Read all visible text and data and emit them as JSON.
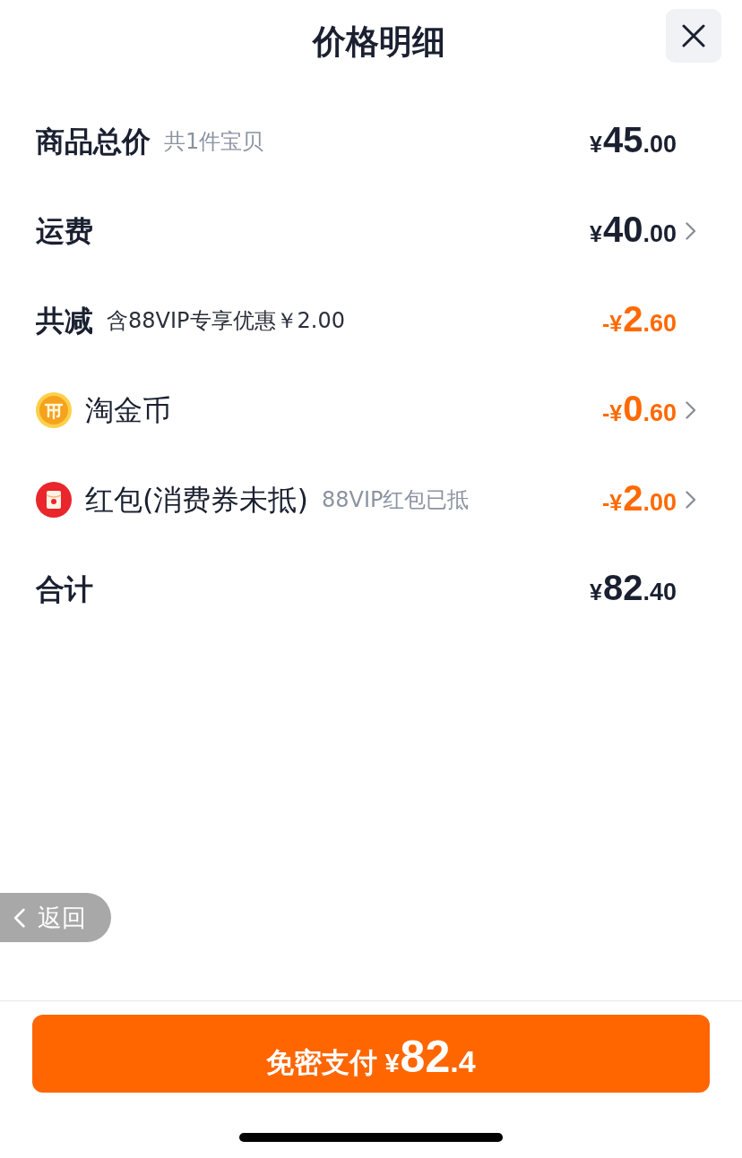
{
  "title": "价格明细",
  "rows": [
    {
      "kind": "line",
      "label": "商品总价",
      "note": {
        "text": "共1件宝贝",
        "muted": true
      },
      "amount": "¥45.00",
      "discount": false,
      "chevron": false
    },
    {
      "kind": "line",
      "label": "运费",
      "amount": "¥40.00",
      "discount": false,
      "chevron": true
    },
    {
      "kind": "line",
      "label": "共减",
      "note": {
        "text": "含88VIP专享优惠￥2.00",
        "muted": false
      },
      "amount": "-¥2.60",
      "discount": true,
      "chevron": false
    },
    {
      "kind": "coin",
      "label": "淘金币",
      "amount": "-¥0.60",
      "discount": true,
      "chevron": true
    },
    {
      "kind": "packet",
      "label": "红包(消费券未抵)",
      "note": {
        "text": "88VIP红包已抵",
        "muted": true
      },
      "amount": "-¥2.00",
      "discount": true,
      "chevron": true
    },
    {
      "kind": "line",
      "label": "合计",
      "amount": "¥82.40",
      "discount": false,
      "chevron": false
    }
  ],
  "back_button": {
    "label": "返回"
  },
  "pay_button": {
    "label": "免密支付",
    "amount": "¥82.4"
  }
}
